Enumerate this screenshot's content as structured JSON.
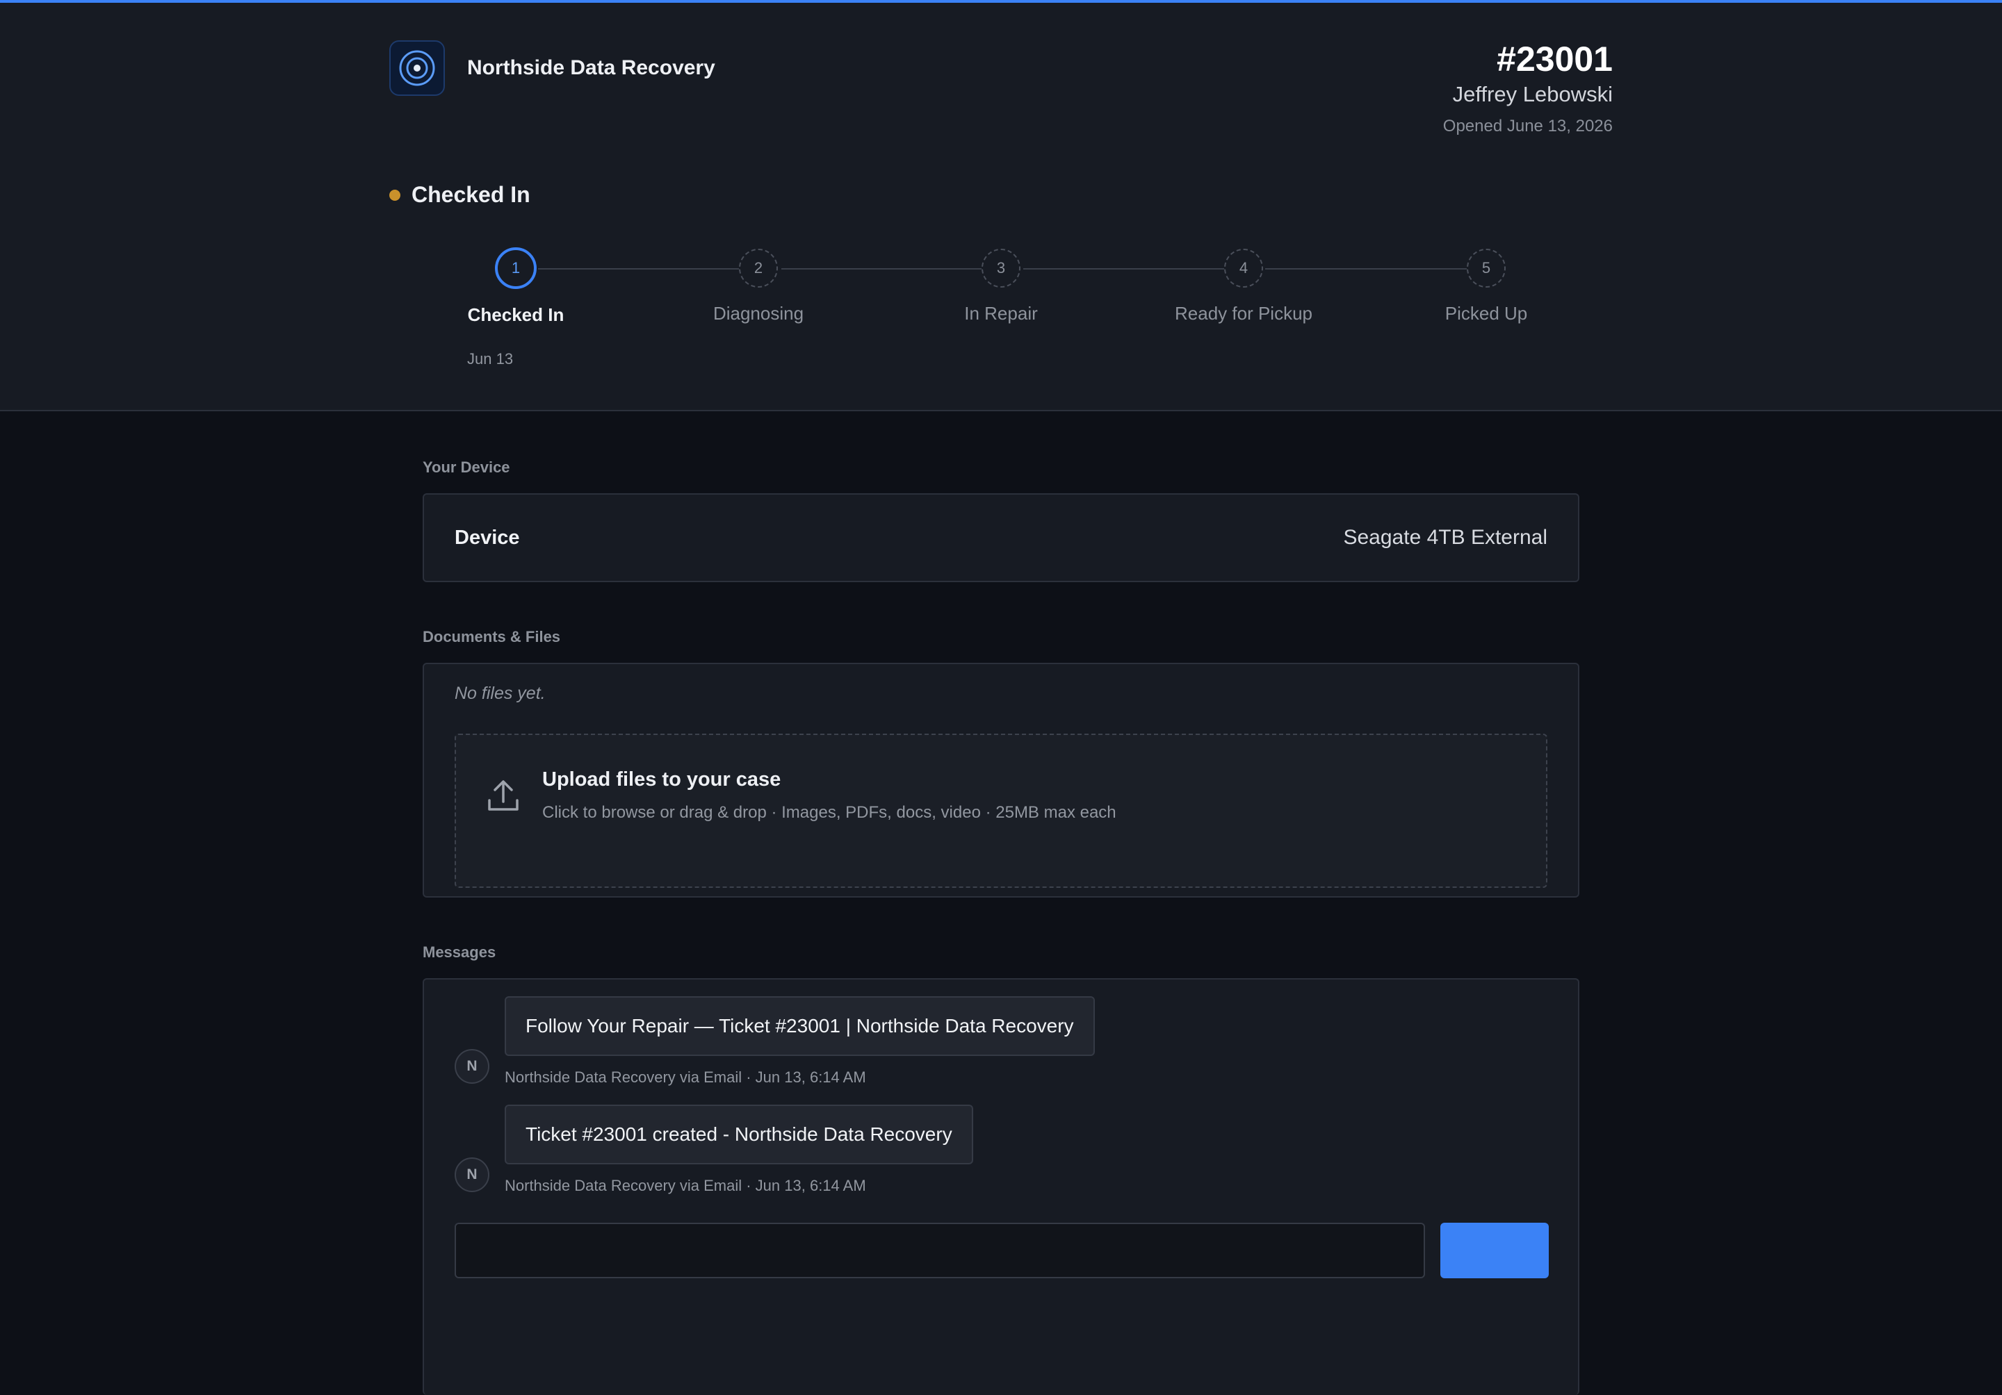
{
  "brand": {
    "name": "Northside Data Recovery",
    "logo_icon": "target-icon",
    "accent": "#3b82f6"
  },
  "ticket": {
    "number": "#23001",
    "customer": "Jeffrey Lebowski",
    "opened": "Opened June 13, 2026"
  },
  "status": {
    "label": "Checked In",
    "dot_color": "#c9912b"
  },
  "steps": [
    {
      "num": "1",
      "label": "Checked In",
      "date": "Jun 13",
      "state": "active"
    },
    {
      "num": "2",
      "label": "Diagnosing",
      "state": "pending"
    },
    {
      "num": "3",
      "label": "In Repair",
      "state": "pending"
    },
    {
      "num": "4",
      "label": "Ready for Pickup",
      "state": "pending"
    },
    {
      "num": "5",
      "label": "Picked Up",
      "state": "pending"
    }
  ],
  "device_section": {
    "heading": "Your Device",
    "key": "Device",
    "value": "Seagate 4TB External"
  },
  "files_section": {
    "heading": "Documents & Files",
    "empty_text": "No files yet.",
    "upload_title": "Upload files to your case",
    "upload_hint": "Click to browse or drag & drop · Images, PDFs, docs, video · 25MB max each",
    "upload_icon": "upload-icon"
  },
  "messages_section": {
    "heading": "Messages",
    "items": [
      {
        "avatar": "N",
        "text": "Follow Your Repair — Ticket #23001 | Northside Data Recovery",
        "meta": "Northside Data Recovery via Email · Jun 13, 6:14 AM"
      },
      {
        "avatar": "N",
        "text": "Ticket #23001 created - Northside Data Recovery",
        "meta": "Northside Data Recovery via Email · Jun 13, 6:14 AM"
      }
    ]
  }
}
